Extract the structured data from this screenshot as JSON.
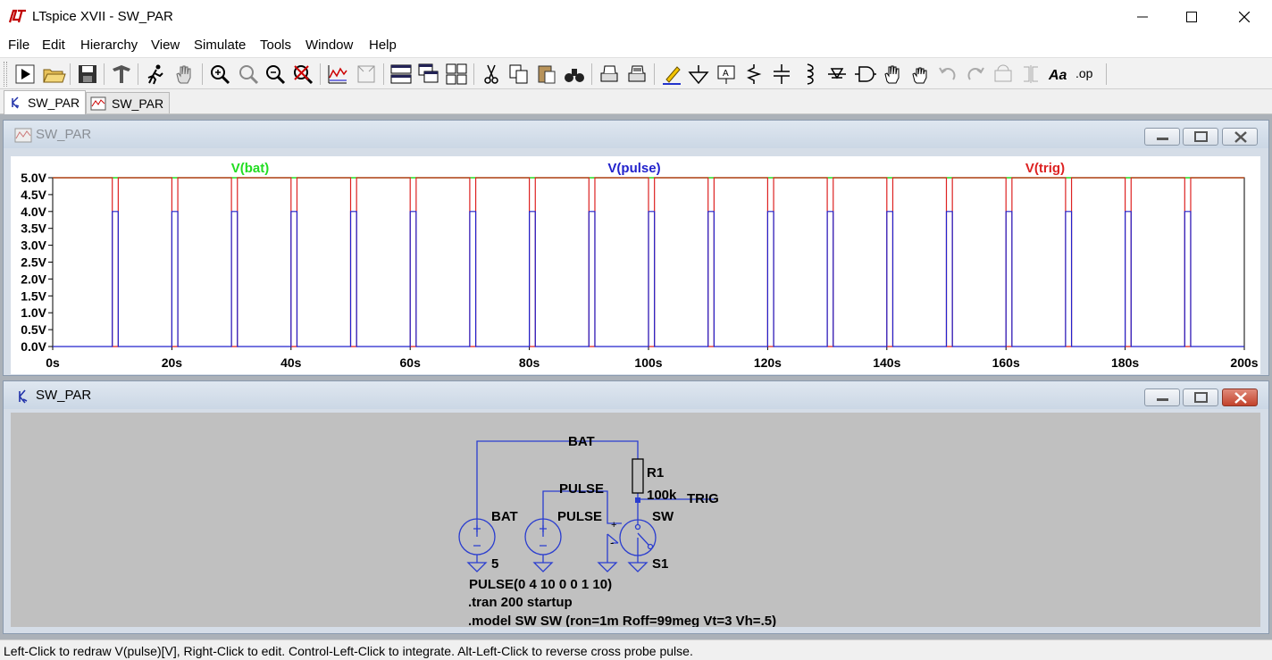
{
  "window": {
    "title": "LTspice XVII - SW_PAR"
  },
  "menu": [
    "File",
    "Edit",
    "Hierarchy",
    "View",
    "Simulate",
    "Tools",
    "Window",
    "Help"
  ],
  "toolbar": {
    "icons": [
      "run-icon",
      "open-folder-icon",
      "save-icon",
      "control-panel-icon",
      "run-man-icon",
      "pan-hand-icon",
      "zoom-in-icon",
      "zoom-all-icon",
      "zoom-out-icon",
      "zoom-cancel-icon",
      "autorange-icon",
      "autorange-off-icon",
      "tile-horizontal-icon",
      "cascade-icon",
      "tile-icon",
      "cut-icon",
      "copy-icon",
      "paste-icon",
      "find-icon",
      "print-icon",
      "print-setup-icon",
      "draw-wire-icon",
      "ground-icon",
      "label-net-icon",
      "resistor-icon",
      "capacitor-icon",
      "inductor-icon",
      "diode-icon",
      "component-icon",
      "move-icon",
      "drag-icon",
      "undo-icon",
      "redo-icon",
      "rotate-icon",
      "mirror-icon",
      "text-icon",
      "spice-directive-icon"
    ]
  },
  "tabs": [
    {
      "label": "SW_PAR",
      "kind": "schematic",
      "active": true
    },
    {
      "label": "SW_PAR",
      "kind": "waveform",
      "active": false
    }
  ],
  "plot_window": {
    "title": "SW_PAR"
  },
  "schematic_window": {
    "title": "SW_PAR"
  },
  "colors": {
    "bat": "#22dd22",
    "pulse": "#2222cc",
    "trig": "#dd2222",
    "schematic_wire": "#2a3dcf"
  },
  "chart_data": {
    "type": "line",
    "xlabel": "",
    "ylabel": "",
    "xlim": [
      0,
      200
    ],
    "ylim": [
      0,
      5
    ],
    "x_ticks": [
      "0s",
      "20s",
      "40s",
      "60s",
      "80s",
      "100s",
      "120s",
      "140s",
      "160s",
      "180s",
      "200s"
    ],
    "y_ticks": [
      "0.0V",
      "0.5V",
      "1.0V",
      "1.5V",
      "2.0V",
      "2.5V",
      "3.0V",
      "3.5V",
      "4.0V",
      "4.5V",
      "5.0V"
    ],
    "series": [
      {
        "name": "V(bat)",
        "color": "#22dd22",
        "x": [
          0,
          200
        ],
        "y": [
          5,
          5
        ]
      },
      {
        "name": "V(pulse)",
        "color": "#2222cc",
        "period": 10,
        "high": 4,
        "high_start": 10,
        "high_end": 11
      },
      {
        "name": "V(trig)",
        "color": "#dd2222",
        "period": 10,
        "high": 5,
        "low_start": 10,
        "low_end": 11
      }
    ]
  },
  "schematic": {
    "net_bat_top": "BAT",
    "v1_label": "BAT",
    "v1_value": "5",
    "v2_name": "PULSE",
    "v2_value": "PULSE",
    "r1_name": "R1",
    "r1_value": "100k",
    "trig_label": "TRIG",
    "sw_name": "S1",
    "sw_model": "SW",
    "v2_spec": "PULSE(0 4 10 0 0 1 10)",
    "directive_tran": ".tran 200 startup",
    "directive_model": ".model SW SW (ron=1m Roff=99meg Vt=3 Vh=.5)"
  },
  "status": {
    "text": "Left-Click to redraw V(pulse)[V],  Right-Click to edit. Control-Left-Click to integrate. Alt-Left-Click to reverse cross probe pulse."
  }
}
